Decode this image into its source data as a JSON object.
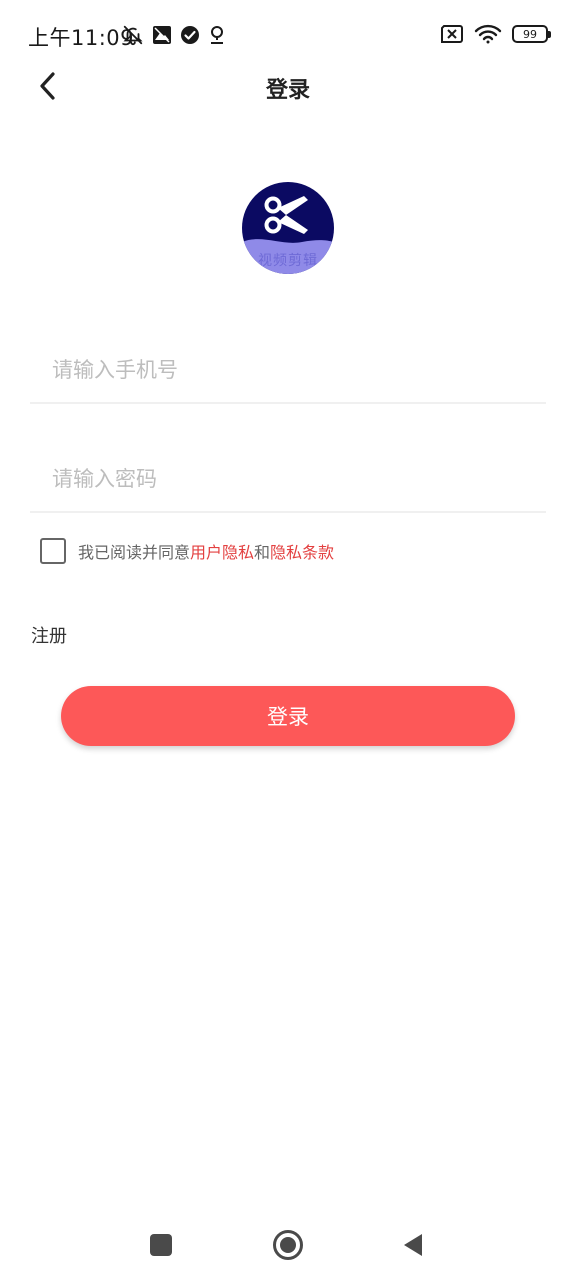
{
  "status_bar": {
    "time": "上午11:09",
    "battery_level": "99",
    "icons": [
      "bell-off-icon",
      "image-icon",
      "check-circle-icon",
      "location-icon",
      "sim-x-icon",
      "wifi-icon",
      "battery-icon"
    ]
  },
  "header": {
    "title": "登录",
    "back_icon": "chevron-left-icon"
  },
  "logo": {
    "caption": "视频剪辑",
    "icon": "scissors-icon",
    "colors": {
      "background": "#0b0a62",
      "wave": "#8f8ae8"
    }
  },
  "form": {
    "phone_placeholder": "请输入手机号",
    "phone_value": "",
    "password_placeholder": "请输入密码",
    "password_value": ""
  },
  "agreement": {
    "checked": false,
    "prefix": "我已阅读并同意",
    "link_privacy": "用户隐私",
    "connector": "和",
    "link_terms": "隐私条款"
  },
  "register_label": "注册",
  "login_button_label": "登录",
  "colors": {
    "accent": "#fd5858",
    "link": "#e34040"
  },
  "nav_bar": {
    "icons": [
      "recents-square-icon",
      "home-circle-icon",
      "back-triangle-icon"
    ]
  }
}
